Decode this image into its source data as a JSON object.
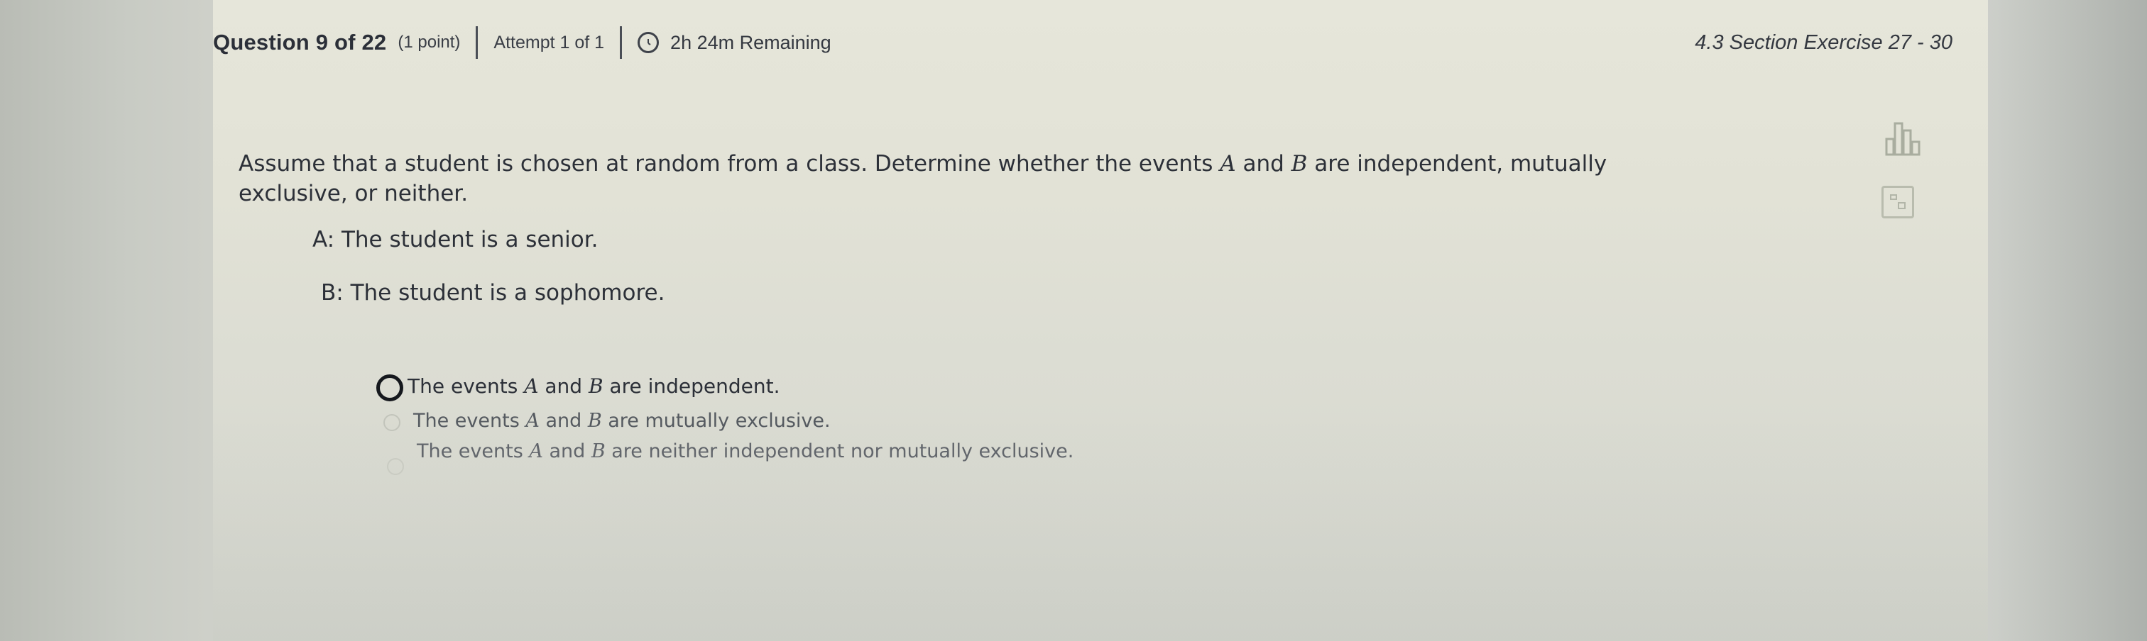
{
  "header": {
    "question_label": "Question 9 of 22",
    "points": "(1 point)",
    "attempt": "Attempt 1 of 1",
    "time_remaining": "2h 24m Remaining",
    "section": "4.3 Section Exercise 27 - 30"
  },
  "question": {
    "text_part1": "Assume that a student is chosen at random from a class. Determine whether the events ",
    "var_a": "A",
    "text_and": " and ",
    "var_b": "B",
    "text_part2": " are independent, mutually",
    "text_line2": "exclusive, or neither.",
    "event_a": "A: The student is a senior.",
    "event_b": "B: The student is a sophomore."
  },
  "options": [
    {
      "pre": "The events ",
      "a": "A",
      "mid": " and ",
      "b": "B",
      "post": " are independent.",
      "selected": false
    },
    {
      "pre": "The events ",
      "a": "A",
      "mid": " and ",
      "b": "B",
      "post": " are mutually exclusive.",
      "selected": false
    },
    {
      "pre": "The events ",
      "a": "A",
      "mid": " and ",
      "b": "B",
      "post": " are neither independent nor mutually exclusive.",
      "selected": false
    }
  ],
  "icons": {
    "clock": "clock-icon",
    "chart": "bar-chart-icon",
    "calculator": "calculator-icon"
  },
  "colors": {
    "text": "#2c3038",
    "panel": "#e3e3d7",
    "radio_border": "#15181d"
  }
}
